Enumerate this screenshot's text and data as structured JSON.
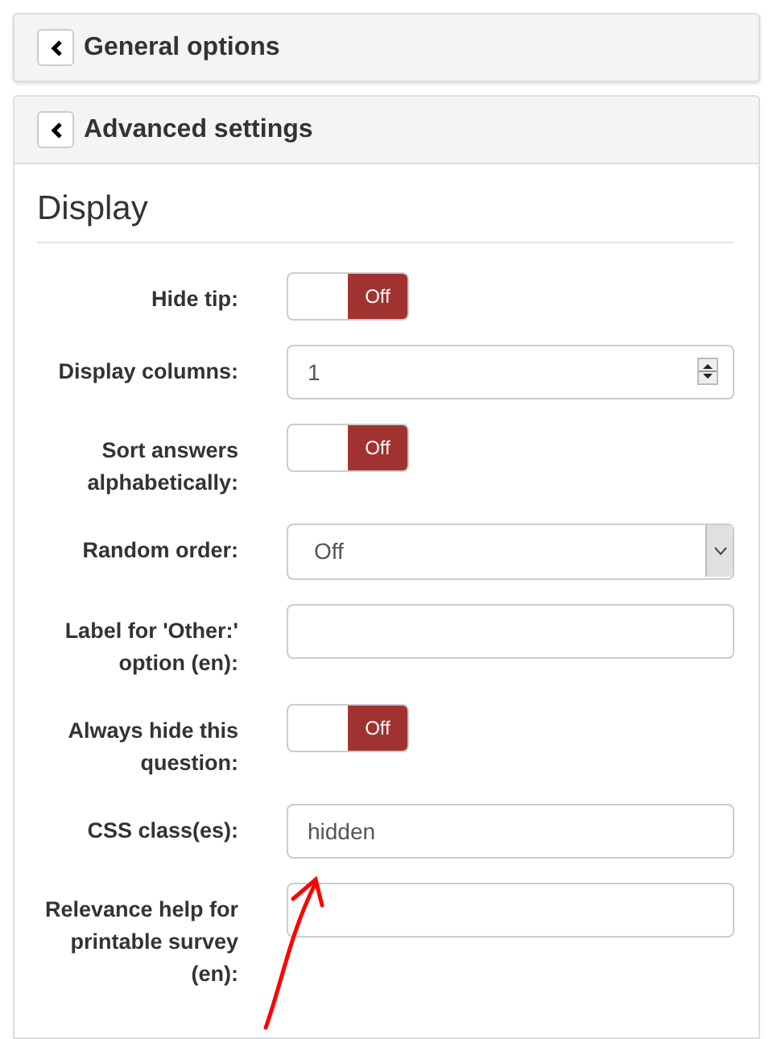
{
  "panels": [
    {
      "title": "General options"
    },
    {
      "title": "Advanced settings",
      "section": {
        "title": "Display"
      },
      "fields": [
        {
          "kind": "switch",
          "label": "Hide tip:",
          "on": false,
          "state_label": "Off"
        },
        {
          "kind": "number",
          "label": "Display columns:",
          "value": "1"
        },
        {
          "kind": "switch",
          "label": "Sort answers alphabetically:",
          "on": false,
          "state_label": "Off"
        },
        {
          "kind": "select",
          "label": "Random order:",
          "value": "Off"
        },
        {
          "kind": "text",
          "label": "Label for 'Other:' option (en):"
        },
        {
          "kind": "switch",
          "label": "Always hide this question:",
          "on": false,
          "state_label": "Off"
        },
        {
          "kind": "text",
          "label": "CSS class(es):",
          "value": "hidden"
        },
        {
          "kind": "text",
          "label": "Relevance help for printable survey (en):"
        }
      ]
    }
  ]
}
